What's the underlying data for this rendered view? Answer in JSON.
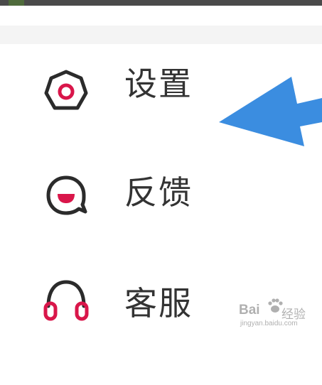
{
  "menu": {
    "items": [
      {
        "label": "设置",
        "icon": "settings-icon"
      },
      {
        "label": "反馈",
        "icon": "feedback-icon"
      },
      {
        "label": "客服",
        "icon": "customer-service-icon"
      }
    ]
  },
  "colors": {
    "icon_dark": "#2b2b2b",
    "icon_accent": "#d9164a",
    "arrow": "#3b8de0",
    "label": "#333333"
  },
  "watermark": {
    "brand": "Bai",
    "brand_suffix": "经验",
    "url": "jingyan.baidu.com"
  }
}
